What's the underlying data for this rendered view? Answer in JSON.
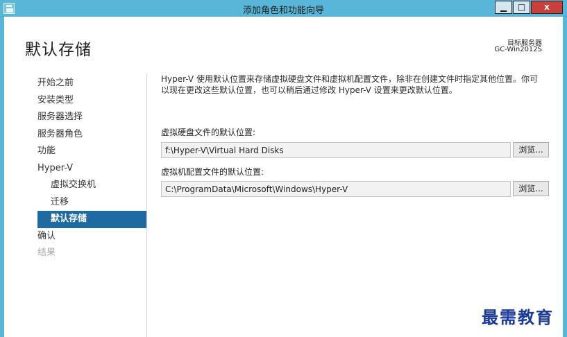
{
  "window": {
    "title": "添加角色和功能向导",
    "min_glyph": "▁",
    "max_glyph": "□",
    "close_glyph": "x"
  },
  "header": {
    "page_title": "默认存储",
    "target_label": "目标服务器",
    "target_value": "GC-Win2012S"
  },
  "sidebar": {
    "items": [
      {
        "label": "开始之前",
        "state": "normal"
      },
      {
        "label": "安装类型",
        "state": "normal"
      },
      {
        "label": "服务器选择",
        "state": "normal"
      },
      {
        "label": "服务器角色",
        "state": "normal"
      },
      {
        "label": "功能",
        "state": "normal"
      },
      {
        "label": "Hyper-V",
        "state": "normal"
      },
      {
        "label": "虚拟交换机",
        "state": "sub"
      },
      {
        "label": "迁移",
        "state": "sub"
      },
      {
        "label": "默认存储",
        "state": "active"
      },
      {
        "label": "确认",
        "state": "normal"
      },
      {
        "label": "结果",
        "state": "disabled"
      }
    ]
  },
  "main": {
    "intro_line1": "Hyper-V 使用默认位置来存储虚拟硬盘文件和虚拟机配置文件，除非在创建文件时指定其他位置。你可",
    "intro_line2": "以现在更改这些默认位置，也可以稍后通过修改 Hyper-V 设置来更改默认位置。",
    "vhd_label": "虚拟硬盘文件的默认位置:",
    "vhd_value": "f:\\Hyper-V\\Virtual Hard Disks",
    "vm_label": "虚拟机配置文件的默认位置:",
    "vm_value": "C:\\ProgramData\\Microsoft\\Windows\\Hyper-V",
    "browse_label": "浏览..."
  },
  "watermark": "最需教育",
  "colors": {
    "titlebar": "#58b7d9",
    "active_nav": "#1f6aa0",
    "close_button": "#c9403a",
    "watermark": "#1a3a9e"
  }
}
